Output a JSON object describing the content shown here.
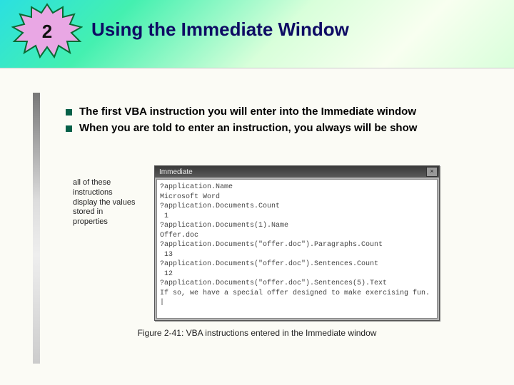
{
  "badge": {
    "number": "2"
  },
  "title": "Using the Immediate Window",
  "bullets": [
    "The first VBA instruction you will enter into the Immediate window",
    "When you are told to enter an instruction, you always will be show"
  ],
  "figure": {
    "callout": "all of these instructions display the values stored in properties",
    "window_title": "Immediate",
    "code_lines": [
      "?application.Name",
      "Microsoft Word",
      "?application.Documents.Count",
      " 1",
      "?application.Documents(1).Name",
      "Offer.doc",
      "?application.Documents(\"offer.doc\").Paragraphs.Count",
      " 13",
      "?application.Documents(\"offer.doc\").Sentences.Count",
      " 12",
      "?application.Documents(\"offer.doc\").Sentences(5).Text",
      "If so, we have a special offer designed to make exercising fun.",
      "|"
    ],
    "caption": "Figure 2-41:  VBA instructions entered in the Immediate window"
  }
}
